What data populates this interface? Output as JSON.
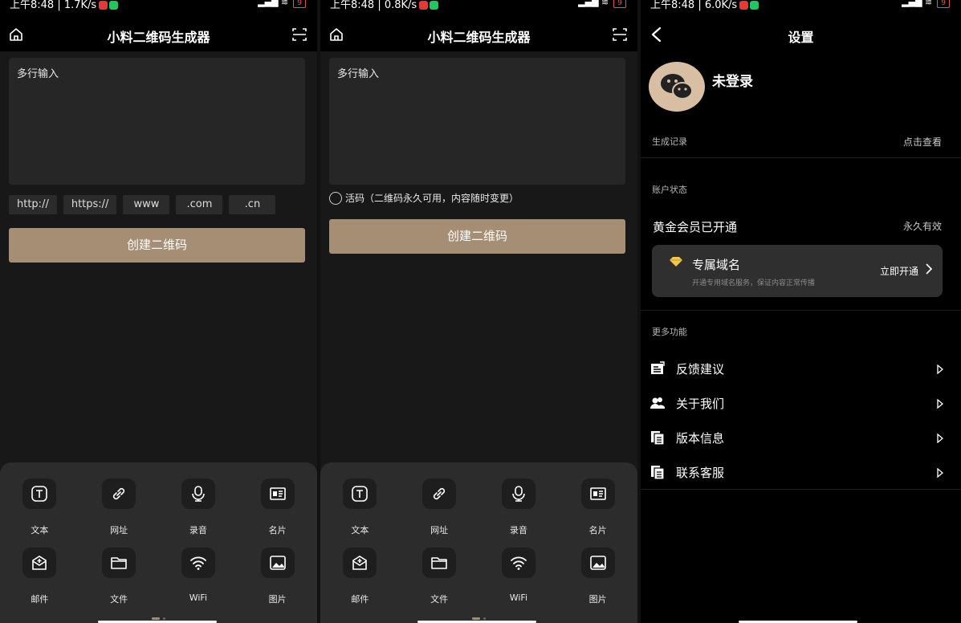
{
  "status": {
    "screen1_text": "上午8:48 | 1.7K/s",
    "screen2_text": "上午8:48 | 0.8K/s",
    "screen3_text": "上午8:48 | 6.0K/s",
    "battery": "9"
  },
  "generator": {
    "title": "小料二维码生成器",
    "textarea_placeholder": "多行输入",
    "chips": [
      "http://",
      "https://",
      "www",
      ".com",
      ".cn"
    ],
    "create_label": "创建二维码",
    "live_code_label": "活码（二维码永久可用，内容随时变更）",
    "types": [
      {
        "label": "文本",
        "icon": "text-icon"
      },
      {
        "label": "网址",
        "icon": "link-icon"
      },
      {
        "label": "录音",
        "icon": "microphone-icon"
      },
      {
        "label": "名片",
        "icon": "business-card-icon"
      },
      {
        "label": "邮件",
        "icon": "mail-icon"
      },
      {
        "label": "文件",
        "icon": "folder-icon"
      },
      {
        "label": "WiFi",
        "icon": "wifi-icon"
      },
      {
        "label": "图片",
        "icon": "image-icon"
      }
    ],
    "colors": {
      "accent": "#a68e74",
      "panel": "#2c2c2c",
      "bg": "#181818"
    }
  },
  "settings": {
    "title": "设置",
    "login_status": "未登录",
    "history_label": "生成记录",
    "history_action": "点击查看",
    "account_section": "账户状态",
    "membership": "黄金会员已开通",
    "membership_validity": "永久有效",
    "domain": {
      "title": "专属域名",
      "subtitle": "开通专用域名服务，保证内容正常传播",
      "action": "立即开通"
    },
    "more_section": "更多功能",
    "menu": [
      {
        "label": "反馈建议",
        "icon": "feedback-icon"
      },
      {
        "label": "关于我们",
        "icon": "users-icon"
      },
      {
        "label": "版本信息",
        "icon": "document-icon"
      },
      {
        "label": "联系客服",
        "icon": "document-icon"
      }
    ]
  }
}
